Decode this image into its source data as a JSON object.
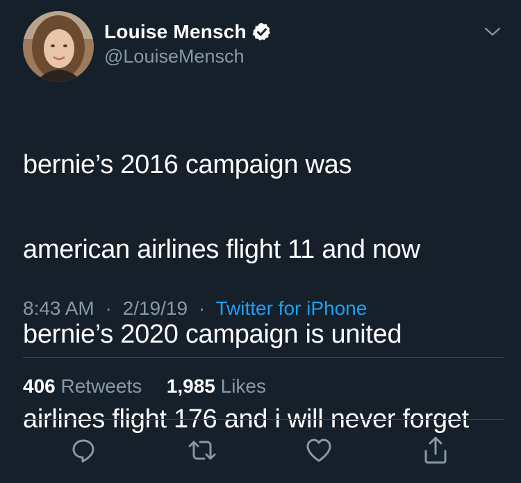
{
  "user": {
    "display_name": "Louise Mensch",
    "handle": "@LouiseMensch",
    "verified": true
  },
  "tweet": {
    "lines": [
      "bernie’s 2016 campaign was",
      "american airlines flight 11 and now",
      "bernie’s 2020 campaign is united",
      "airlines flight 176 and i will never forget"
    ],
    "time": "8:43 AM",
    "date": "2/19/19",
    "separator": "·",
    "source": "Twitter for iPhone"
  },
  "stats": {
    "retweets_count": "406",
    "retweets_label": "Retweets",
    "likes_count": "1,985",
    "likes_label": "Likes"
  },
  "icons": {
    "reply": "reply-icon",
    "retweet": "retweet-icon",
    "like": "heart-icon",
    "share": "share-icon",
    "more": "chevron-down-icon",
    "verified": "verified-badge-icon"
  },
  "colors": {
    "background": "#15202b",
    "text": "#ffffff",
    "secondary": "#8899a6",
    "link": "#1da1f2",
    "divider": "#38444d"
  }
}
